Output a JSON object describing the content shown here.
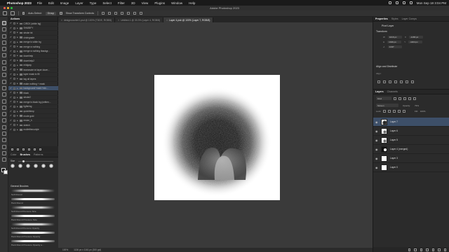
{
  "menubar": {
    "app_name": "Photoshop 2023",
    "items": [
      "File",
      "Edit",
      "Image",
      "Layer",
      "Type",
      "Select",
      "Filter",
      "3D",
      "View",
      "Plugins",
      "Window",
      "Help"
    ],
    "clock": "Mon Sep 18  3:04 PM"
  },
  "window": {
    "title": "Adobe Photoshop 2023"
  },
  "options": {
    "auto_select_label": "Auto-Select:",
    "auto_select_value": "Group",
    "transform_label": "Show Transform Controls"
  },
  "left_panel": {
    "tabs": [
      "Actions"
    ],
    "actions": [
      {
        "name": "CIRCK (white bg)",
        "checked": true,
        "expand": false
      },
      {
        "name": "SHUBIFY",
        "checked": true,
        "expand": false
      },
      {
        "name": "stroke txt",
        "checked": true,
        "expand": false
      },
      {
        "name": "circlegrade",
        "checked": true,
        "expand": false
      },
      {
        "name": "merge is white bg",
        "checked": true,
        "expand": false
      },
      {
        "name": "merge w nothing",
        "checked": true,
        "expand": false
      },
      {
        "name": "merge w nothing tbackgr...",
        "checked": true,
        "expand": false
      },
      {
        "name": "downhelp",
        "checked": true,
        "expand": false
      },
      {
        "name": "downhelp2",
        "checked": true,
        "expand": false
      },
      {
        "name": "midgray",
        "checked": true,
        "expand": false
      },
      {
        "name": "teammate txt layer down...",
        "checked": true,
        "expand": false
      },
      {
        "name": "layer mask to fill",
        "checked": true,
        "expand": false
      },
      {
        "name": "tag all layers",
        "checked": true,
        "expand": false
      },
      {
        "name": "make nothing + mask",
        "checked": true,
        "expand": false
      },
      {
        "name": "background+mark+mix...",
        "checked": true,
        "expand": false,
        "selected": true
      },
      {
        "name": "black",
        "checked": true,
        "expand": false
      },
      {
        "name": "stroke2",
        "checked": true,
        "expand": false
      },
      {
        "name": "merge is black bg (written...",
        "checked": true,
        "expand": false
      },
      {
        "name": "lightning",
        "checked": true,
        "expand": false
      },
      {
        "name": "quickfxtmp",
        "checked": true,
        "expand": false
      },
      {
        "name": "mode gold",
        "checked": true,
        "expand": false
      },
      {
        "name": "resize_h",
        "checked": true,
        "expand": false
      },
      {
        "name": "sketch",
        "checked": true,
        "expand": false
      },
      {
        "name": "mulletthecodyle",
        "checked": true,
        "expand": false
      }
    ],
    "brush_tabs": [
      "Color",
      "Brushes",
      "Patterns"
    ],
    "brush_size": "Size",
    "brush_group": "General Brushes",
    "brushes": [
      "Soft Round",
      "Hard Round",
      "Soft Round Pressure Size",
      "Hard Round Pressure Size",
      "Soft Round Pressure Opacity",
      "Hard Round Pressure Opacity",
      "Hard Round Pressure Opacity a..."
    ]
  },
  "doc_tabs": [
    {
      "label": "designcounter1.psd @ 100% (TDDE, RGB/8)",
      "active": false
    },
    {
      "label": "Untitled-1 @ 33.3% (Layer 4, RGB/8)",
      "active": false
    },
    {
      "label": "Layer 4.psb @ 100% (Layer 7, RGB/8)",
      "active": true
    }
  ],
  "status": {
    "zoom": "100%",
    "doc": "1136 px x 1161 px (300 ppi)"
  },
  "properties": {
    "tabs": [
      "Properties",
      "Styles",
      "Layer Comps"
    ],
    "kind": "Pixel Layer",
    "transform_title": "Transform",
    "w": "1016 px",
    "h": "1016 px",
    "x": "-1166 px",
    "y": "-1164 px",
    "angle": "0.00°",
    "align_title": "Align and Distribute",
    "align_label": "Align:"
  },
  "layers_panel": {
    "tabs": [
      "Layers",
      "Channels"
    ],
    "kind": "Kind",
    "blend": "Screen",
    "opacity_label": "Opacity:",
    "opacity": "79%",
    "lock_label": "Lock:",
    "fill_label": "Fill:",
    "fill": "100%",
    "layers": [
      {
        "name": "Layer 7",
        "thumb": "dark",
        "selected": true
      },
      {
        "name": "Layer 6",
        "thumb": "light",
        "selected": false
      },
      {
        "name": "Layer 5",
        "thumb": "light",
        "selected": false
      },
      {
        "name": "Layer 4 (merged)",
        "thumb": "black",
        "selected": false
      },
      {
        "name": "Layer 3",
        "thumb": "white",
        "selected": false
      },
      {
        "name": "Layer 0",
        "thumb": "white",
        "selected": false
      }
    ]
  }
}
